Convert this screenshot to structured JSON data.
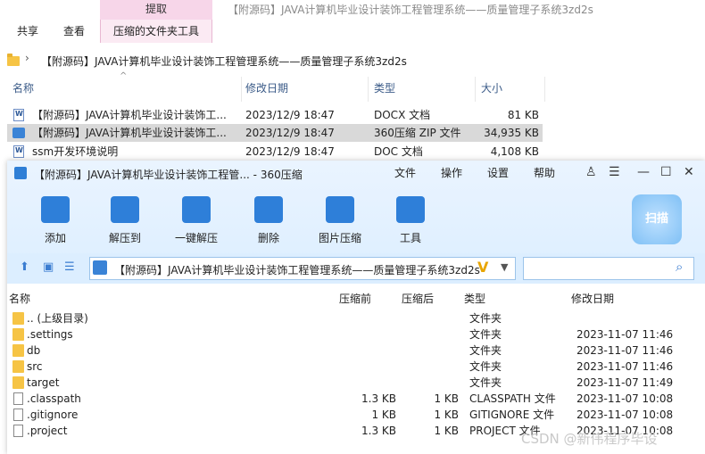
{
  "explorer": {
    "context_tab": "提取",
    "window_title": "【附源码】JAVA计算机毕业设计装饰工程管理系统——质量管理子系统3zd2s",
    "tabs": [
      "共享",
      "查看",
      "压缩的文件夹工具"
    ],
    "path": "【附源码】JAVA计算机毕业设计装饰工程管理系统——质量管理子系统3zd2s",
    "columns": {
      "name": "名称",
      "date": "修改日期",
      "type": "类型",
      "size": "大小"
    },
    "files": [
      {
        "name": "【附源码】JAVA计算机毕业设计装饰工...",
        "date": "2023/12/9 18:47",
        "type": "DOCX 文档",
        "size": "81 KB",
        "icon": "docx-icon"
      },
      {
        "name": "【附源码】JAVA计算机毕业设计装饰工...",
        "date": "2023/12/9 18:47",
        "type": "360压缩 ZIP 文件",
        "size": "34,935 KB",
        "icon": "zip-icon"
      },
      {
        "name": "ssm开发环境说明",
        "date": "2023/12/9 18:47",
        "type": "DOC 文档",
        "size": "4,108 KB",
        "icon": "doc-icon"
      }
    ]
  },
  "zip360": {
    "title": "【附源码】JAVA计算机毕业设计装饰工程管... - 360压缩",
    "menu": [
      "文件",
      "操作",
      "设置",
      "帮助"
    ],
    "tools": [
      "添加",
      "解压到",
      "一键解压",
      "删除",
      "图片压缩",
      "工具"
    ],
    "scan_label": "扫描",
    "path": "【附源码】JAVA计算机毕业设计装饰工程管理系统——质量管理子系统3zd2s",
    "columns": {
      "name": "名称",
      "before": "压缩前",
      "after": "压缩后",
      "type": "类型",
      "date": "修改日期"
    },
    "rows": [
      {
        "name": ".. (上级目录)",
        "before": "",
        "after": "",
        "type": "文件夹",
        "date": "",
        "kind": "folder"
      },
      {
        "name": ".settings",
        "before": "",
        "after": "",
        "type": "文件夹",
        "date": "2023-11-07 11:46",
        "kind": "folder"
      },
      {
        "name": "db",
        "before": "",
        "after": "",
        "type": "文件夹",
        "date": "2023-11-07 11:46",
        "kind": "folder"
      },
      {
        "name": "src",
        "before": "",
        "after": "",
        "type": "文件夹",
        "date": "2023-11-07 11:46",
        "kind": "folder"
      },
      {
        "name": "target",
        "before": "",
        "after": "",
        "type": "文件夹",
        "date": "2023-11-07 11:49",
        "kind": "folder"
      },
      {
        "name": ".classpath",
        "before": "1.3 KB",
        "after": "1 KB",
        "type": "CLASSPATH 文件",
        "date": "2023-11-07 10:08",
        "kind": "file"
      },
      {
        "name": ".gitignore",
        "before": "1 KB",
        "after": "1 KB",
        "type": "GITIGNORE 文件",
        "date": "2023-11-07 10:08",
        "kind": "file"
      },
      {
        "name": ".project",
        "before": "1.3 KB",
        "after": "1 KB",
        "type": "PROJECT 文件",
        "date": "2023-11-07 10:08",
        "kind": "file"
      }
    ]
  },
  "watermark": "CSDN @新伟程序毕设",
  "colors": {
    "accent": "#2e7fd9",
    "context_tab": "#f7d6e9",
    "selected_row": "#d9d9d9",
    "folder": "#f6c445"
  }
}
